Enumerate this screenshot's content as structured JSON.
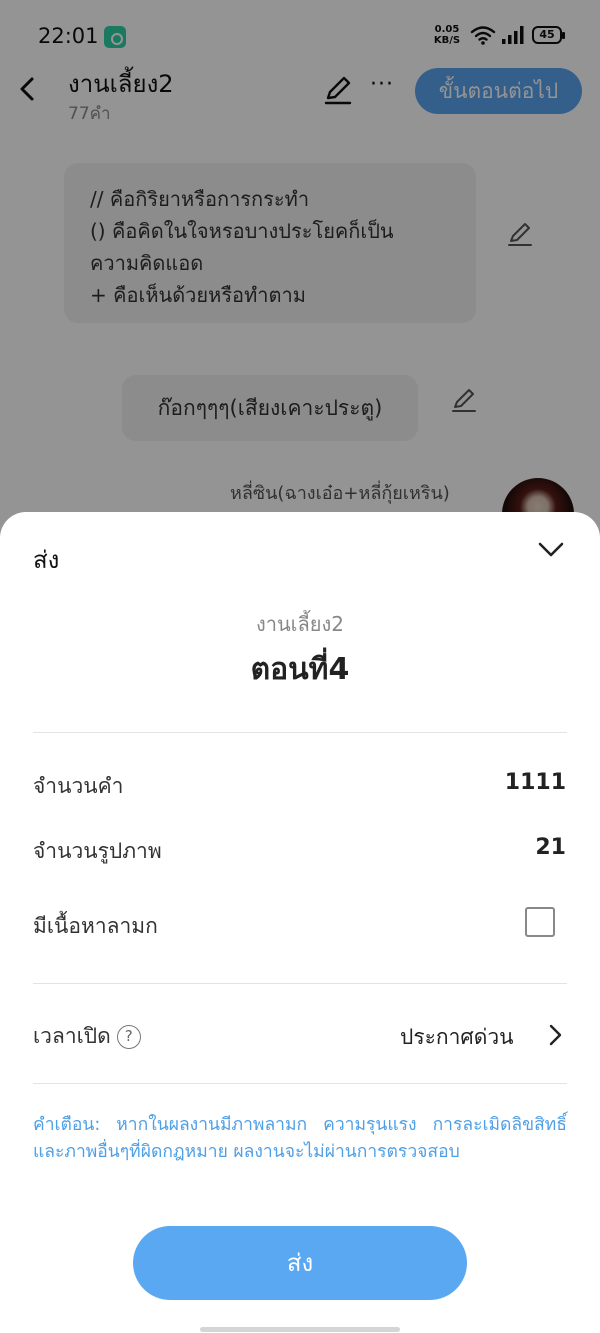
{
  "status_bar": {
    "time": "22:01",
    "net_speed_value": "0.05",
    "net_speed_unit": "KB/S",
    "battery": "45"
  },
  "nav": {
    "title": "งานเลี้ยง2",
    "subtitle": "77คำ",
    "next_button": "ขั้นตอนต่อไป",
    "more": "···"
  },
  "story": {
    "note_lines": [
      "// คือกิริยาหรือการกระทำ",
      "() คือคิดในใจหรอบางประโยคก็เป็น",
      "ความคิดแอด",
      "+ คือเห็นด้วยหรือทำตาม"
    ],
    "sound_bubble": "ก๊อกๆๆๆ(เสียงเคาะประตู)",
    "speaker_name": "หลี่ซิน(ฉางเอ๋อ+หลี่กุ้ยเหริน)"
  },
  "sheet": {
    "title": "ส่ง",
    "work_name": "งานเลี้ยง2",
    "episode": "ตอนที่4",
    "word_count_label": "จำนวนคำ",
    "word_count": "1111",
    "image_count_label": "จำนวนรูปภาพ",
    "image_count": "21",
    "explicit_label": "มีเนื้อหาลามก",
    "explicit_checked": false,
    "publish_time_label": "เวลาเปิด",
    "help_glyph": "?",
    "publish_time_value": "ประกาศด่วน",
    "warning": "คำเตือน: หากในผลงานมีภาพลามก ความรุนแรง การละเมิดลิขสิทธิ์และภาพอื่นๆที่ผิดกฎหมาย ผลงานจะไม่ผ่านการตรวจสอบ",
    "send_button": "ส่ง"
  },
  "colors": {
    "accent": "#5aa8f2",
    "warning_text": "#4f9fe6",
    "brand_badge": "#2fd1a4"
  },
  "icons": [
    "back-icon",
    "edit-icon",
    "more-icon",
    "wifi-icon",
    "signal-icon",
    "battery-icon",
    "collapse-icon",
    "help-icon",
    "chevron-right-icon"
  ]
}
